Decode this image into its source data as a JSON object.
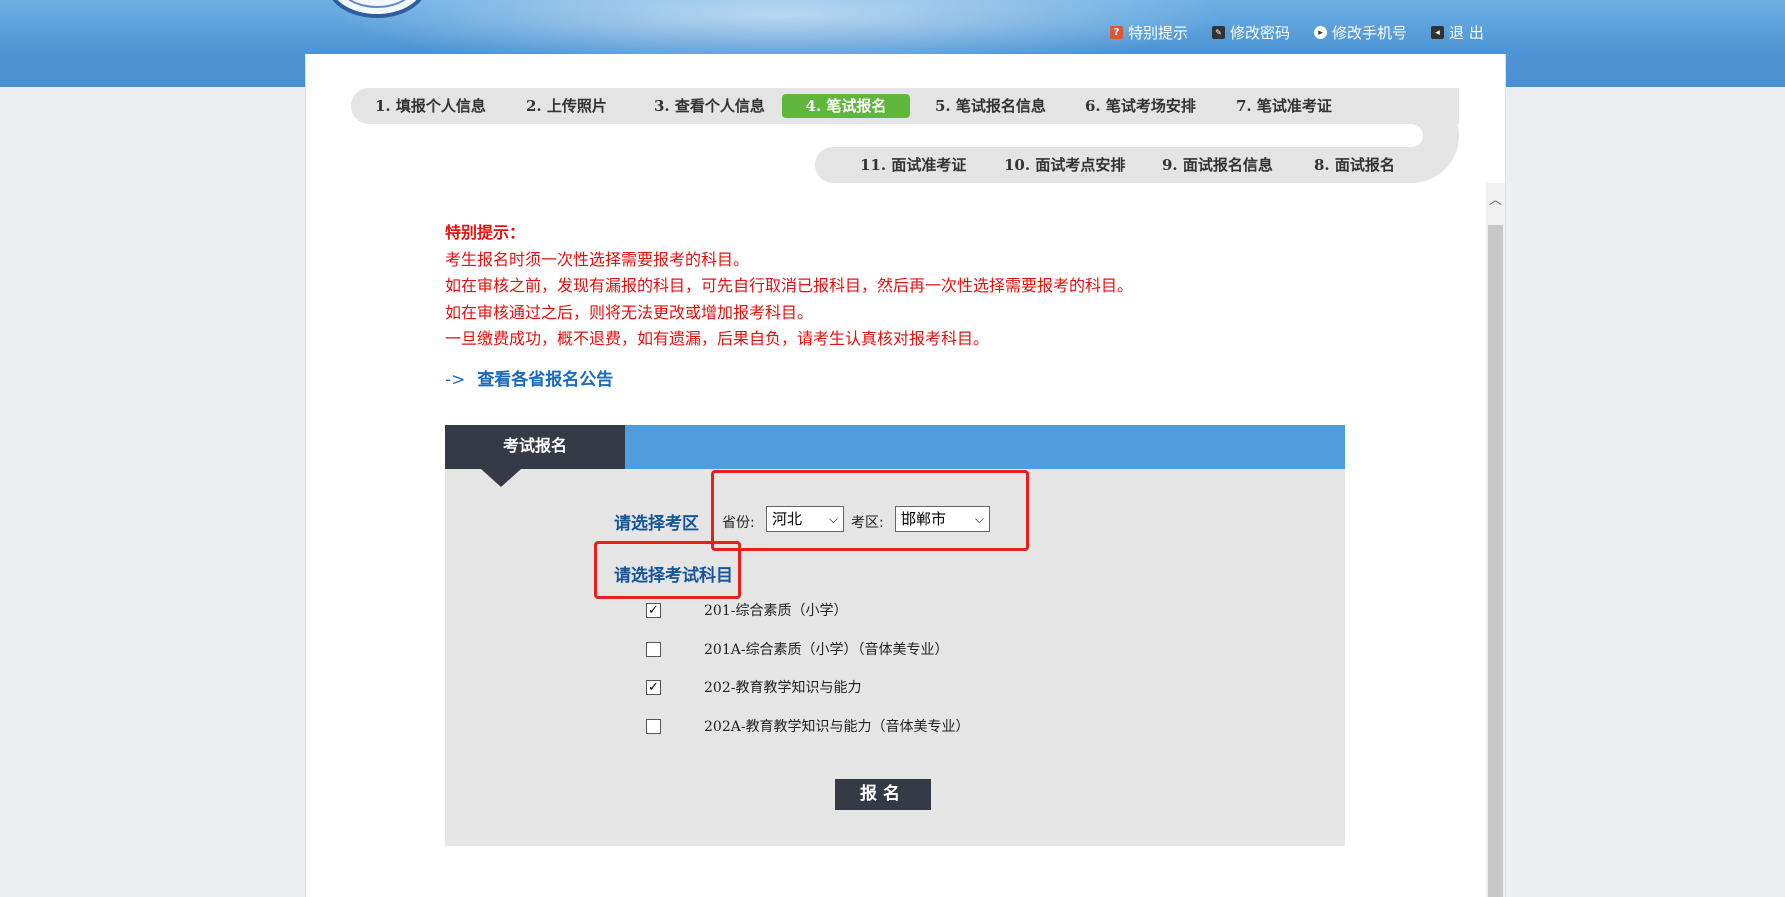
{
  "header": {
    "links": [
      {
        "label": "特别提示",
        "icon": "warning-icon"
      },
      {
        "label": "修改密码",
        "icon": "key-icon"
      },
      {
        "label": "修改手机号",
        "icon": "phone-icon"
      },
      {
        "label": "退 出",
        "icon": "exit-icon"
      }
    ]
  },
  "steps": {
    "row1": [
      "1. 填报个人信息",
      "2. 上传照片",
      "3. 查看个人信息",
      "4. 笔试报名",
      "5. 笔试报名信息",
      "6. 笔试考场安排",
      "7. 笔试准考证"
    ],
    "row2": [
      "11. 面试准考证",
      "10. 面试考点安排",
      "9. 面试报名信息",
      "8. 面试报名"
    ],
    "active": "4. 笔试报名"
  },
  "notice": {
    "title": "特别提示：",
    "lines": [
      "考生报名时须一次性选择需要报考的科目。",
      "如在审核之前，发现有漏报的科目，可先自行取消已报科目，然后再一次性选择需要报考的科目。",
      "如在审核通过之后，则将无法更改或增加报考科目。",
      "一旦缴费成功，概不退费，如有遗漏，后果自负，请考生认真核对报考科目。"
    ]
  },
  "announcement_link": {
    "arrow": "->",
    "text": "查看各省报名公告"
  },
  "panel": {
    "tab_title": "考试报名",
    "region_label": "请选择考区",
    "province_label": "省份:",
    "province_value": "河北",
    "district_label": "考区:",
    "district_value": "邯郸市",
    "subject_label": "请选择考试科目",
    "subjects": [
      {
        "label": "201-综合素质（小学）",
        "checked": true
      },
      {
        "label": "201A-综合素质（小学）（音体美专业）",
        "checked": false
      },
      {
        "label": "202-教育教学知识与能力",
        "checked": true
      },
      {
        "label": "202A-教育教学知识与能力（音体美专业）",
        "checked": false
      }
    ],
    "submit_label": "报名"
  },
  "colors": {
    "active_step": "#5fb63a",
    "notice_text": "#e8100e",
    "highlight_box": "#e5201f",
    "panel_header": "#4f9ddc",
    "dark_tab": "#363a47"
  }
}
